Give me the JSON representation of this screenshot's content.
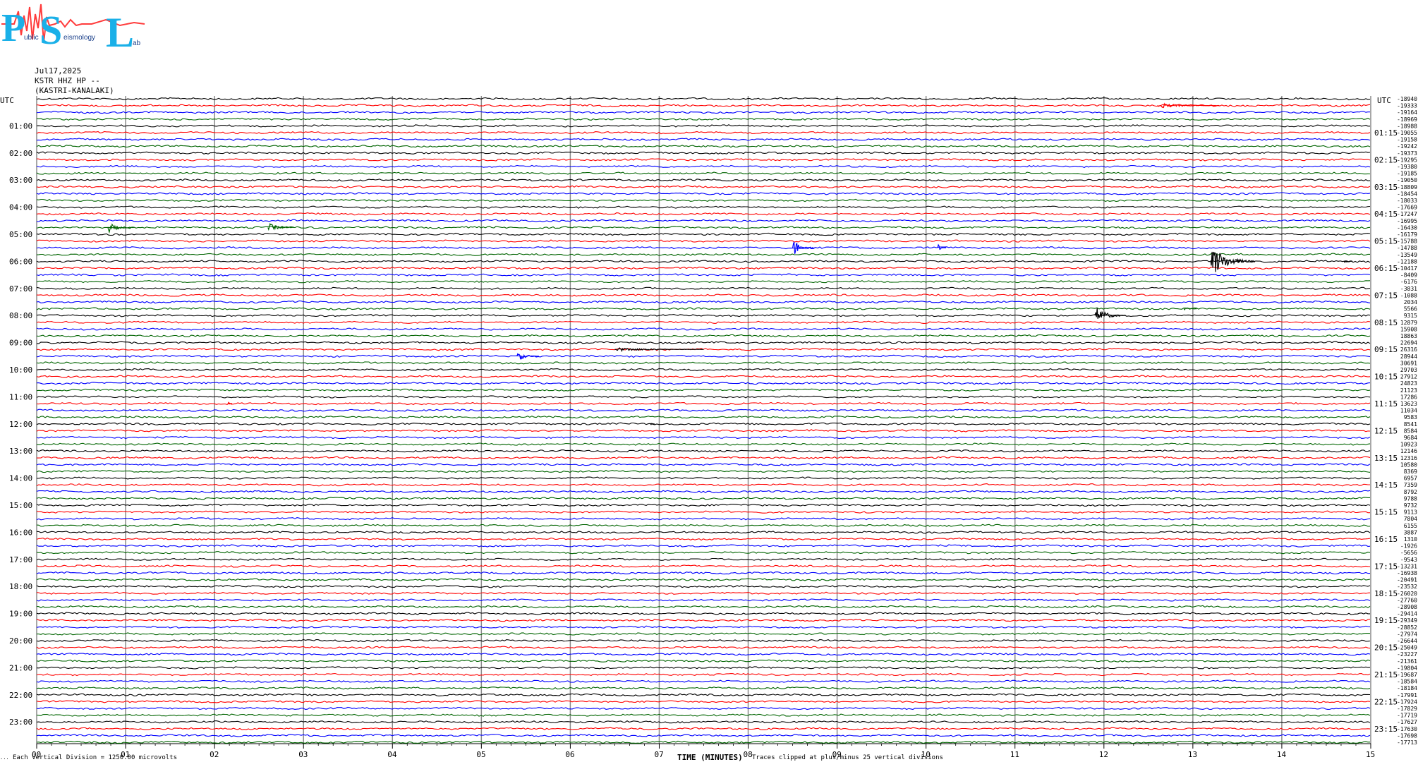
{
  "logo": {
    "letters": [
      "P",
      "S",
      "L"
    ],
    "small_text": [
      "ublic",
      "eismology",
      "ab"
    ]
  },
  "header": {
    "date": "Jul17,2025",
    "station": "KSTR HHZ HP --",
    "location": "(KASTRI-KANALAKI)"
  },
  "axes": {
    "left_utc_label": "UTC",
    "right_utc_label": "UTC",
    "xlabel": "TIME (MINUTES)",
    "scale_note": "Each Vertical Division = 1250.00 microvolts",
    "clip_note": "Traces clipped at plus/minus 25 vertical divisions",
    "corner_mark": "..."
  },
  "chart_data": {
    "type": "line",
    "title": "",
    "x_ticks": [
      "00",
      "01",
      "02",
      "03",
      "04",
      "05",
      "06",
      "07",
      "08",
      "09",
      "10",
      "11",
      "12",
      "13",
      "14",
      "15"
    ],
    "xlim": [
      0,
      15
    ],
    "left_hour_labels": [
      "01:00",
      "02:00",
      "03:00",
      "04:00",
      "05:00",
      "06:00",
      "07:00",
      "08:00",
      "09:00",
      "10:00",
      "11:00",
      "12:00",
      "13:00",
      "14:00",
      "15:00",
      "16:00",
      "17:00",
      "18:00",
      "19:00",
      "20:00",
      "21:00",
      "22:00",
      "23:00"
    ],
    "right_hour_labels": [
      "01:15",
      "02:15",
      "03:15",
      "04:15",
      "05:15",
      "06:15",
      "07:15",
      "08:15",
      "09:15",
      "10:15",
      "11:15",
      "12:15",
      "13:15",
      "14:15",
      "15:15",
      "16:15",
      "17:15",
      "18:15",
      "19:15",
      "20:15",
      "21:15",
      "22:15",
      "23:15"
    ],
    "trace_colors": [
      "#000000",
      "#ff0000",
      "#0000ff",
      "#006400"
    ],
    "trace_offsets": [
      "-18940",
      "-19333",
      "-19164",
      "-18969",
      "-18988",
      "-19055",
      "-19158",
      "-19242",
      "-19373",
      "-19295",
      "-19380",
      "-19185",
      "-19050",
      "-18809",
      "-18454",
      "-18033",
      "-17669",
      "-17247",
      "-16995",
      "-16430",
      "-16179",
      "-15788",
      "-14788",
      "-13549",
      "-12188",
      "-10417",
      "-8409",
      "-6176",
      "-3831",
      "-1088",
      "2034",
      "5566",
      "9315",
      "12879",
      "15908",
      "18863",
      "22694",
      "26316",
      "28944",
      "30691",
      "29703",
      "27912",
      "24823",
      "21123",
      "17286",
      "13623",
      "11034",
      "9583",
      "8541",
      "8584",
      "9684",
      "10923",
      "12146",
      "12316",
      "10580",
      "8369",
      "6957",
      "7359",
      "8792",
      "9788",
      "9732",
      "9113",
      "7804",
      "6155",
      "3887",
      "1310",
      "-1926",
      "-5656",
      "-9543",
      "-13231",
      "-16938",
      "-20491",
      "-23532",
      "-26020",
      "-27760",
      "-28908",
      "-29414",
      "-29349",
      "-28852",
      "-27974",
      "-26644",
      "-25049",
      "-23227",
      "-21361",
      "-19804",
      "-19687",
      "-18584",
      "-18184",
      "-17991",
      "-17924",
      "-17829",
      "-17719",
      "-17627",
      "-17630",
      "-17698",
      "-17713"
    ],
    "events": [
      {
        "trace": 19,
        "minute": 0.8,
        "amplitude": 8,
        "duration_min": 0.3,
        "color": "#006400"
      },
      {
        "trace": 19,
        "minute": 2.6,
        "amplitude": 7,
        "duration_min": 0.3,
        "color": "#006400"
      },
      {
        "trace": 22,
        "minute": 8.5,
        "amplitude": 14,
        "duration_min": 0.25,
        "color": "#0000ff"
      },
      {
        "trace": 22,
        "minute": 10.13,
        "amplitude": 6,
        "duration_min": 0.1,
        "color": "#0000ff"
      },
      {
        "trace": 1,
        "minute": 12.6,
        "amplitude": 4,
        "duration_min": 0.7,
        "color": "#ff0000"
      },
      {
        "trace": 24,
        "minute": 13.2,
        "amplitude": 26,
        "duration_min": 0.5,
        "color": "#000000"
      },
      {
        "trace": 24,
        "minute": 14.7,
        "amplitude": 4,
        "duration_min": 0.1,
        "color": "#000000"
      },
      {
        "trace": 32,
        "minute": 11.9,
        "amplitude": 14,
        "duration_min": 0.35,
        "color": "#000000"
      },
      {
        "trace": 31,
        "minute": 12.9,
        "amplitude": 3,
        "duration_min": 0.15,
        "color": "#006400"
      },
      {
        "trace": 38,
        "minute": 5.4,
        "amplitude": 8,
        "duration_min": 0.25,
        "color": "#0000ff"
      },
      {
        "trace": 37,
        "minute": 6.5,
        "amplitude": 3,
        "duration_min": 1.0,
        "color": "#000000"
      },
      {
        "trace": 45,
        "minute": 2.15,
        "amplitude": 3,
        "duration_min": 0.05,
        "color": "#ff0000"
      },
      {
        "trace": 48,
        "minute": 6.9,
        "amplitude": 2,
        "duration_min": 0.05,
        "color": "#000000"
      }
    ]
  }
}
